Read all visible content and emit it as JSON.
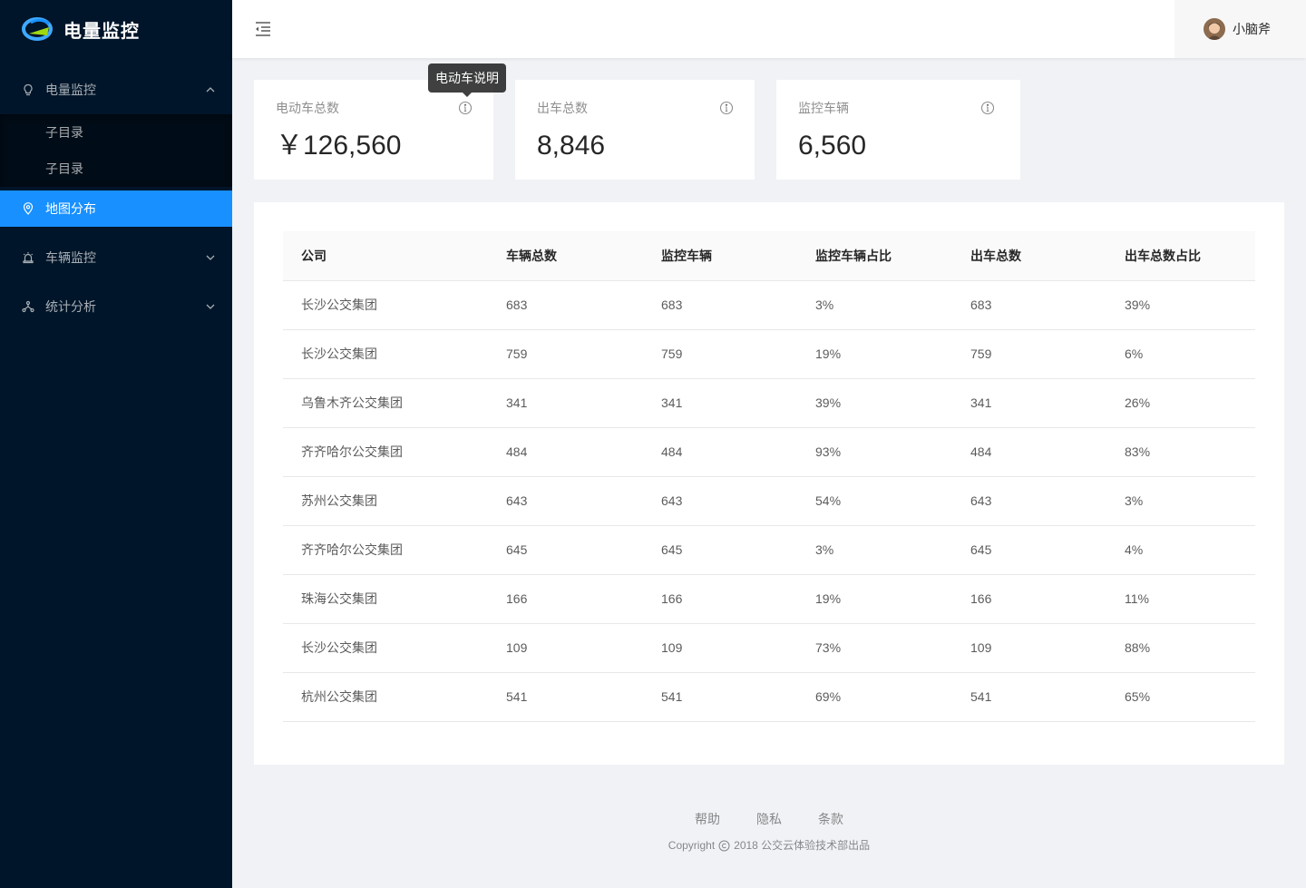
{
  "app": {
    "title": "电量监控",
    "brand_color": "#1890ff",
    "sider_color": "#001529"
  },
  "sidebar": {
    "items": [
      {
        "label": "电量监控",
        "icon": "bulb-icon",
        "expanded": true
      },
      {
        "label": "子目录"
      },
      {
        "label": "子目录"
      },
      {
        "label": "地图分布",
        "icon": "environment-icon",
        "selected": true
      },
      {
        "label": "车辆监控",
        "icon": "alarm-icon",
        "expanded": false
      },
      {
        "label": "统计分析",
        "icon": "cluster-icon",
        "expanded": false
      }
    ]
  },
  "header": {
    "username": "小脑斧",
    "menu_fold_icon": "menu-fold-icon"
  },
  "stats": [
    {
      "label": "电动车总数",
      "value": "￥126,560",
      "tooltip": "电动车说明"
    },
    {
      "label": "出车总数",
      "value": "8,846"
    },
    {
      "label": "监控车辆",
      "value": "6,560"
    }
  ],
  "table": {
    "columns": [
      "公司",
      "车辆总数",
      "监控车辆",
      "监控车辆占比",
      "出车总数",
      "出车总数占比"
    ],
    "rows": [
      [
        "长沙公交集团",
        "683",
        "683",
        "3%",
        "683",
        "39%"
      ],
      [
        "长沙公交集团",
        "759",
        "759",
        "19%",
        "759",
        "6%"
      ],
      [
        "乌鲁木齐公交集团",
        "341",
        "341",
        "39%",
        "341",
        "26%"
      ],
      [
        "齐齐哈尔公交集团",
        "484",
        "484",
        "93%",
        "484",
        "83%"
      ],
      [
        "苏州公交集团",
        "643",
        "643",
        "54%",
        "643",
        "3%"
      ],
      [
        "齐齐哈尔公交集团",
        "645",
        "645",
        "3%",
        "645",
        "4%"
      ],
      [
        "珠海公交集团",
        "166",
        "166",
        "19%",
        "166",
        "11%"
      ],
      [
        "长沙公交集团",
        "109",
        "109",
        "73%",
        "109",
        "88%"
      ],
      [
        "杭州公交集团",
        "541",
        "541",
        "69%",
        "541",
        "65%"
      ]
    ]
  },
  "footer": {
    "links": [
      "帮助",
      "隐私",
      "条款"
    ],
    "copyright_prefix": "Copyright",
    "copyright_text": "2018 公交云体验技术部出品"
  }
}
